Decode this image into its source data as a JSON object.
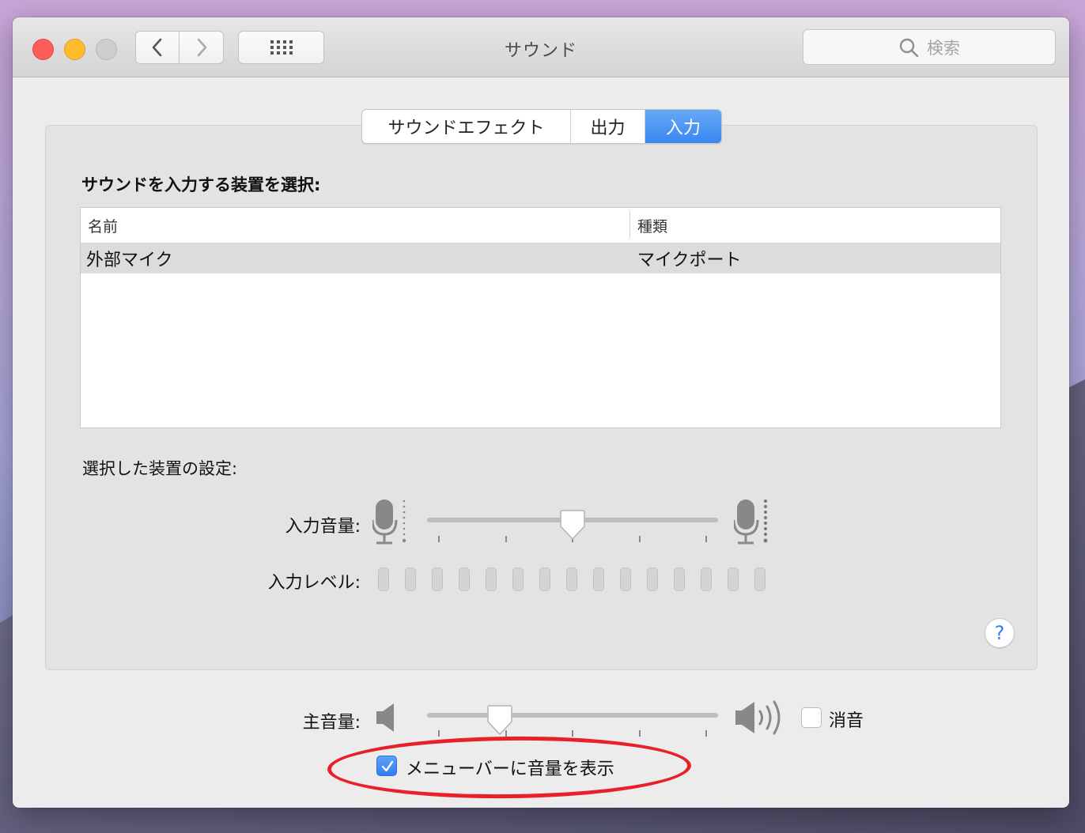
{
  "window": {
    "title": "サウンド"
  },
  "toolbar": {
    "search_placeholder": "検索"
  },
  "tabs": [
    {
      "label": "サウンドエフェクト",
      "active": false
    },
    {
      "label": "出力",
      "active": false
    },
    {
      "label": "入力",
      "active": true
    }
  ],
  "input": {
    "device_section_title": "サウンドを入力する装置を選択:",
    "table": {
      "columns": [
        "名前",
        "種類"
      ],
      "rows": [
        {
          "name": "外部マイク",
          "type": "マイクポート",
          "selected": true
        }
      ]
    },
    "settings_title": "選択した装置の設定:",
    "input_volume_label": "入力音量:",
    "input_volume": 0.5,
    "input_level_label": "入力レベル:",
    "input_level_segments": 15,
    "input_level_active": 0
  },
  "footer": {
    "main_volume_label": "主音量:",
    "main_volume": 0.25,
    "mute_label": "消音",
    "mute_checked": false,
    "show_in_menubar_label": "メニューバーに音量を表示",
    "show_in_menubar_checked": true
  },
  "help": {
    "symbol": "?"
  },
  "colors": {
    "accent": "#3a87f0",
    "highlight_oval": "#e8202a"
  }
}
